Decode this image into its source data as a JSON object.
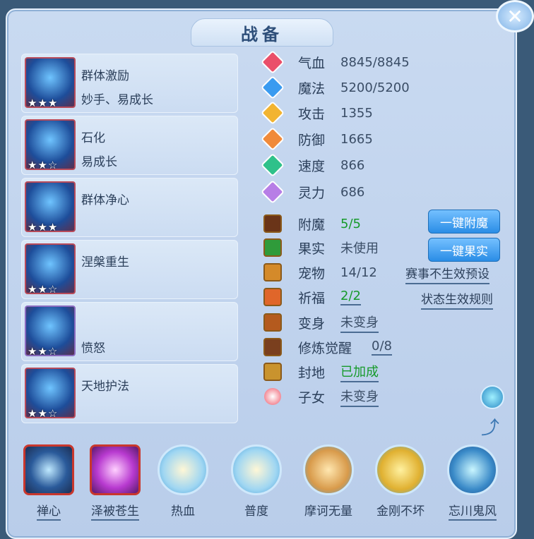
{
  "title": "战备",
  "skills": [
    {
      "name": "群体激励",
      "sub": "妙手、易成长",
      "stars": "★★★",
      "icon": "skill-1-icon"
    },
    {
      "name": "石化",
      "sub": "易成长",
      "stars": "★★☆",
      "icon": "skill-2-icon"
    },
    {
      "name": "群体净心",
      "sub": "",
      "stars": "★★★",
      "icon": "skill-3-icon"
    },
    {
      "name": "涅槃重生",
      "sub": "",
      "stars": "★★☆",
      "icon": "skill-4-icon"
    },
    {
      "name": "",
      "sub": "愤怒",
      "stars": "★★☆",
      "icon": "skill-5-icon"
    },
    {
      "name": "天地护法",
      "sub": "",
      "stars": "★★☆",
      "icon": "skill-6-icon"
    }
  ],
  "attributes": [
    {
      "label": "气血",
      "value": "8845/8845",
      "color": "#ea4f6a"
    },
    {
      "label": "魔法",
      "value": "5200/5200",
      "color": "#3a9bf0"
    },
    {
      "label": "攻击",
      "value": "1355",
      "color": "#f2b431"
    },
    {
      "label": "防御",
      "value": "1665",
      "color": "#f08a3a"
    },
    {
      "label": "速度",
      "value": "866",
      "color": "#2fc18a"
    },
    {
      "label": "灵力",
      "value": "686",
      "color": "#b77ee6"
    }
  ],
  "extras": [
    {
      "label": "附魔",
      "value": "5/5"
    },
    {
      "label": "果实",
      "value": "未使用"
    },
    {
      "label": "宠物",
      "value": "14/12"
    },
    {
      "label": "祈福",
      "value": "2/2"
    },
    {
      "label": "变身",
      "value": "未变身"
    },
    {
      "label": "修炼觉醒",
      "value": "0/8"
    },
    {
      "label": "封地",
      "value": "已加成"
    },
    {
      "label": "子女",
      "value": "未变身"
    }
  ],
  "buttons": {
    "enchant": "一键附魔",
    "fruit": "一键果实"
  },
  "links": {
    "pet_rule": "赛事不生效预设",
    "bless_rule": "状态生效规则"
  },
  "bottom_skills": [
    "禅心",
    "泽被苍生",
    "热血",
    "普度",
    "摩诃无量",
    "金刚不坏",
    "忘川鬼风"
  ],
  "colors": {
    "accent": "#2a8de6",
    "positive": "#169a2a"
  }
}
